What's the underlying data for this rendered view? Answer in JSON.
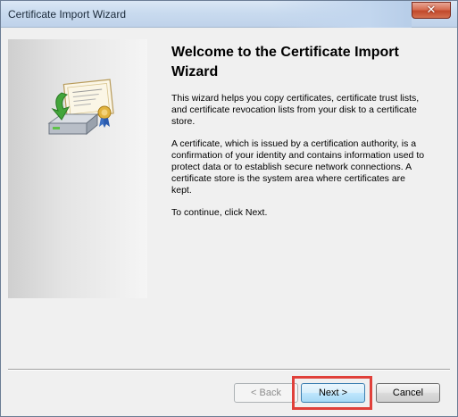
{
  "window": {
    "title": "Certificate Import Wizard",
    "close_glyph": "✕"
  },
  "main": {
    "heading": "Welcome to the Certificate Import Wizard",
    "paragraphs": [
      "This wizard helps you copy certificates, certificate trust lists, and certificate revocation lists from your disk to a certificate store.",
      "A certificate, which is issued by a certification authority, is a confirmation of your identity and contains information used to protect data or to establish secure network connections. A certificate store is the system area where certificates are kept.",
      "To continue, click Next."
    ]
  },
  "buttons": {
    "back": "< Back",
    "next": "Next >",
    "cancel": "Cancel"
  },
  "icons": {
    "certificate": "certificate-import-icon",
    "close": "close-icon"
  },
  "colors": {
    "highlight": "#e0403a",
    "titlebar": "#c9dbef",
    "close_button": "#c2492b"
  }
}
